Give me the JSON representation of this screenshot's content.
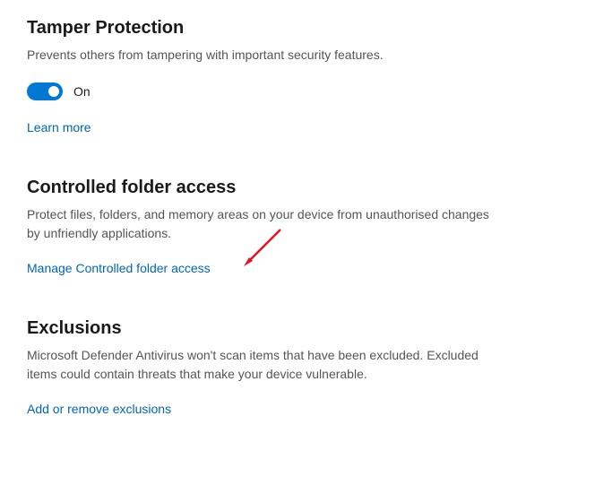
{
  "tamper": {
    "title": "Tamper Protection",
    "desc": "Prevents others from tampering with important security features.",
    "toggle_state": "On",
    "learn_more": "Learn more"
  },
  "cfa": {
    "title": "Controlled folder access",
    "desc": "Protect files, folders, and memory areas on your device from unauthorised changes by unfriendly applications.",
    "manage": "Manage Controlled folder access"
  },
  "exclusions": {
    "title": "Exclusions",
    "desc": "Microsoft Defender Antivirus won't scan items that have been excluded. Excluded items could contain threats that make your device vulnerable.",
    "add_remove": "Add or remove exclusions"
  },
  "colors": {
    "accent": "#0078d4",
    "link": "#0066b4",
    "arrow": "#e81123"
  }
}
